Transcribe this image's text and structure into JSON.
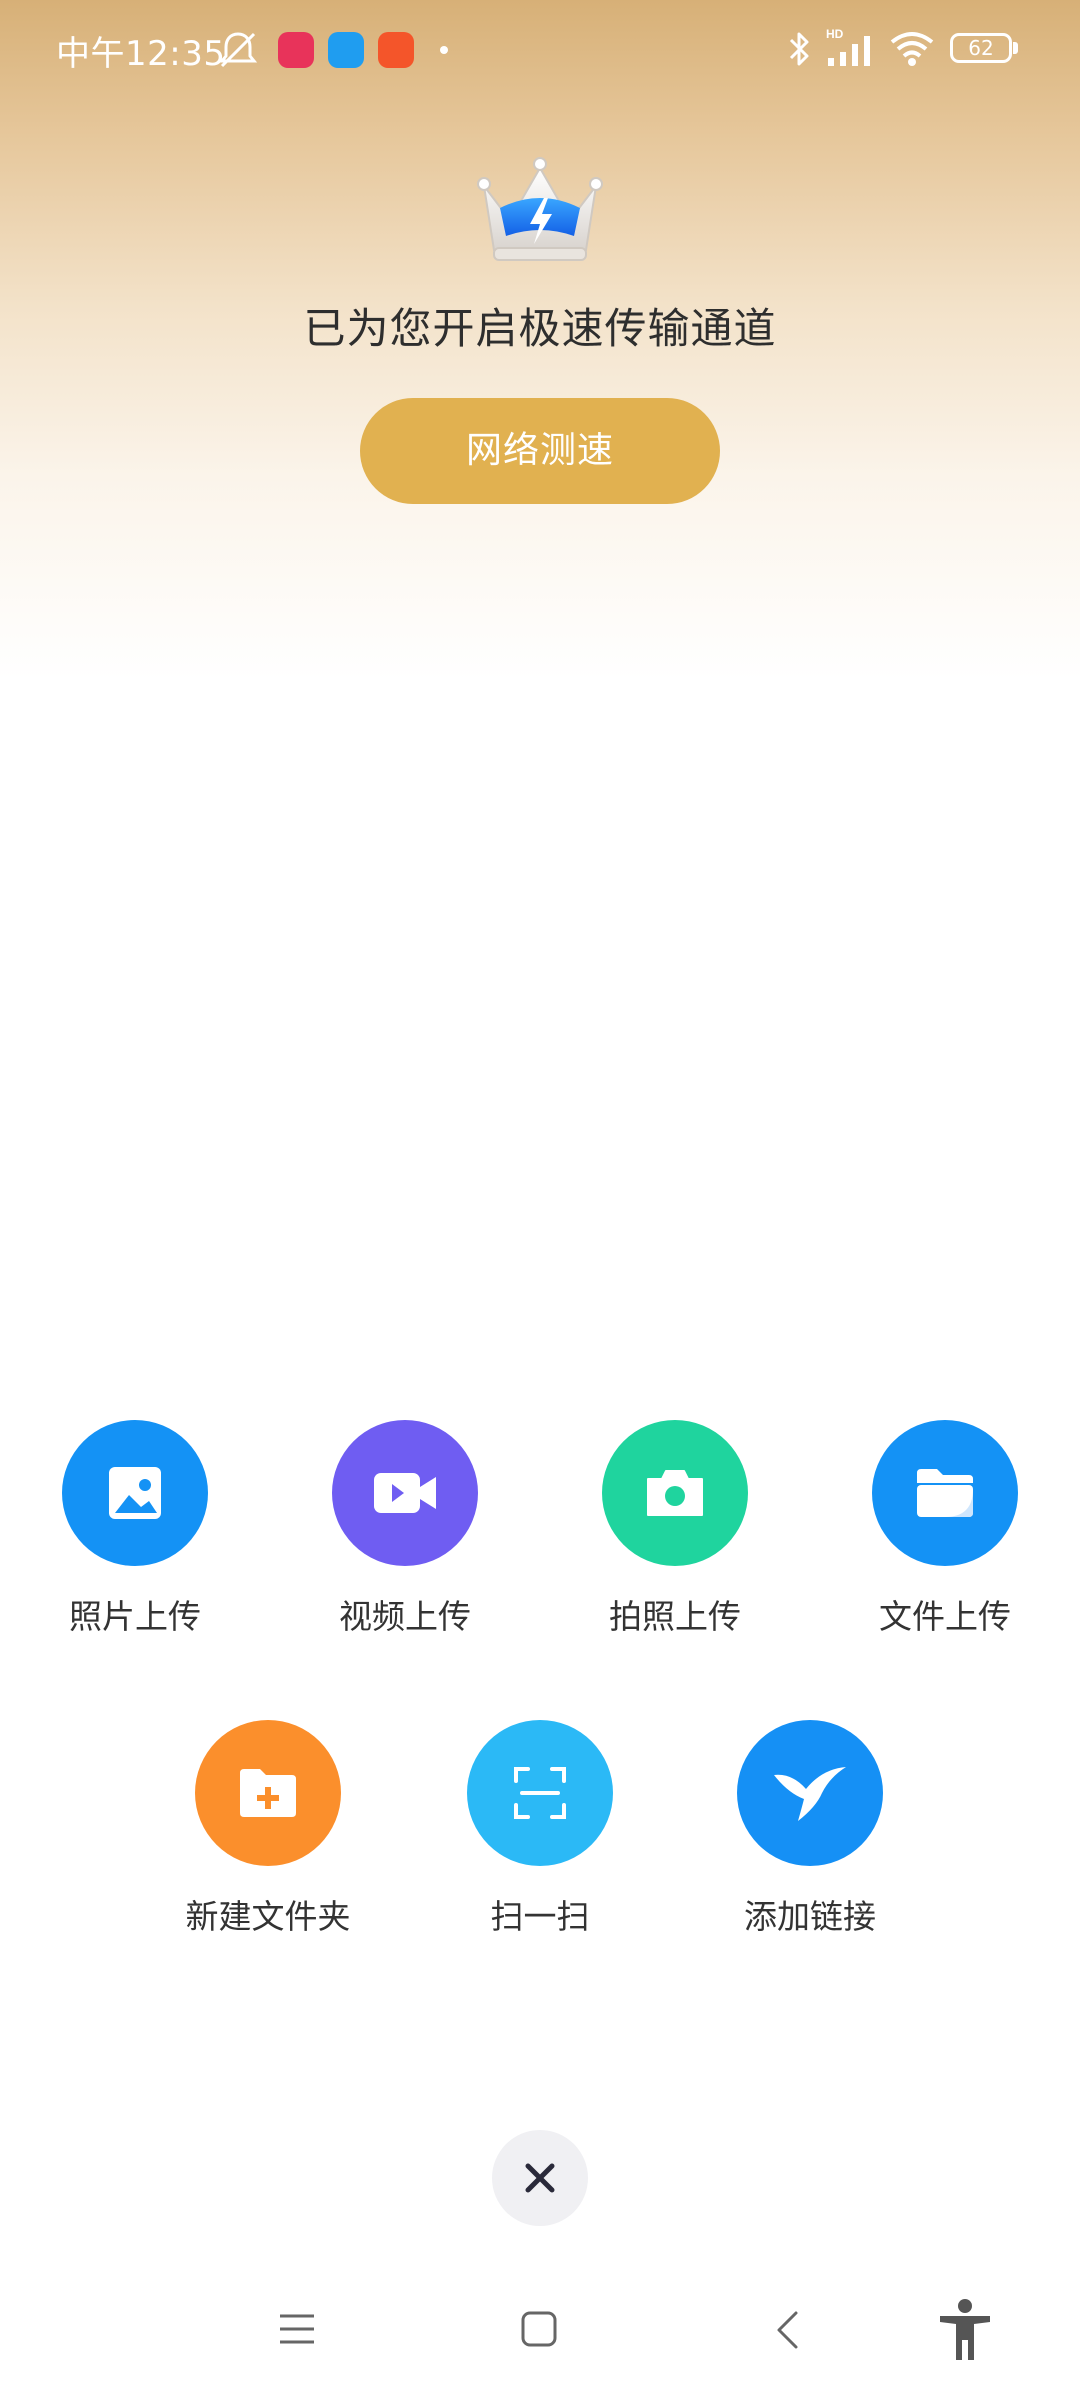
{
  "status_bar": {
    "time": "中午12:35",
    "battery": "62",
    "signal_label": "HD"
  },
  "header": {
    "headline": "已为您开启极速传输通道",
    "speed_test_button": "网络测速"
  },
  "actions": [
    {
      "label": "照片上传",
      "icon": "photo-icon",
      "color": "#1492f5"
    },
    {
      "label": "视频上传",
      "icon": "video-icon",
      "color": "#6f5df2"
    },
    {
      "label": "拍照上传",
      "icon": "camera-icon",
      "color": "#1fd49e"
    },
    {
      "label": "文件上传",
      "icon": "folder-icon",
      "color": "#1492f5"
    },
    {
      "label": "新建文件夹",
      "icon": "new-folder-icon",
      "color": "#fb8f2c"
    },
    {
      "label": "扫一扫",
      "icon": "scan-icon",
      "color": "#2bb9f6"
    },
    {
      "label": "添加链接",
      "icon": "bird-link-icon",
      "color": "#1590f5"
    }
  ],
  "close": {
    "icon": "close-icon"
  },
  "nav_bar": {
    "icons": [
      "menu-icon",
      "home-icon",
      "back-icon",
      "accessibility-icon"
    ]
  },
  "colors": {
    "accent_gold": "#e1b150",
    "header_gradient_top": "#d7b077"
  }
}
